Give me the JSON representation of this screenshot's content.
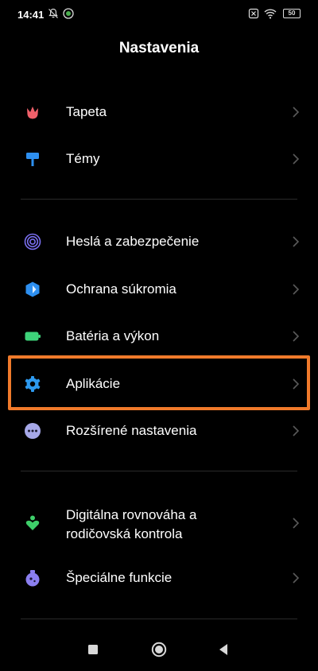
{
  "status_bar": {
    "time": "14:41",
    "battery": "50"
  },
  "header": {
    "title": "Nastavenia"
  },
  "sections": [
    {
      "items": [
        {
          "label": "Tapeta",
          "icon": "tulip-icon"
        },
        {
          "label": "Témy",
          "icon": "paint-roller-icon"
        }
      ]
    },
    {
      "items": [
        {
          "label": "Heslá a zabezpečenie",
          "icon": "fingerprint-icon"
        },
        {
          "label": "Ochrana súkromia",
          "icon": "privacy-shield-icon"
        },
        {
          "label": "Batéria a výkon",
          "icon": "battery-icon"
        },
        {
          "label": "Aplikácie",
          "icon": "gear-icon",
          "highlighted": true
        },
        {
          "label": "Rozšírené nastavenia",
          "icon": "more-dots-icon"
        }
      ]
    },
    {
      "items": [
        {
          "label_line1": "Digitálna rovnováha a",
          "label_line2": "rodičovská kontrola",
          "icon": "heart-person-icon"
        },
        {
          "label": "Špeciálne funkcie",
          "icon": "special-flask-icon"
        }
      ]
    }
  ],
  "colors": {
    "background": "#000000",
    "highlight": "#f07a2b",
    "wallpaper_icon": "#f0606a",
    "themes_icon": "#2d8ff0",
    "security_icon": "#7a6ff0",
    "privacy_icon": "#2d8ff0",
    "battery_icon": "#3ed37a",
    "apps_icon": "#2d9af0",
    "advanced_icon": "#a6a8e8",
    "wellbeing_icon": "#3ecf6a",
    "special_icon": "#8b7ff0"
  }
}
